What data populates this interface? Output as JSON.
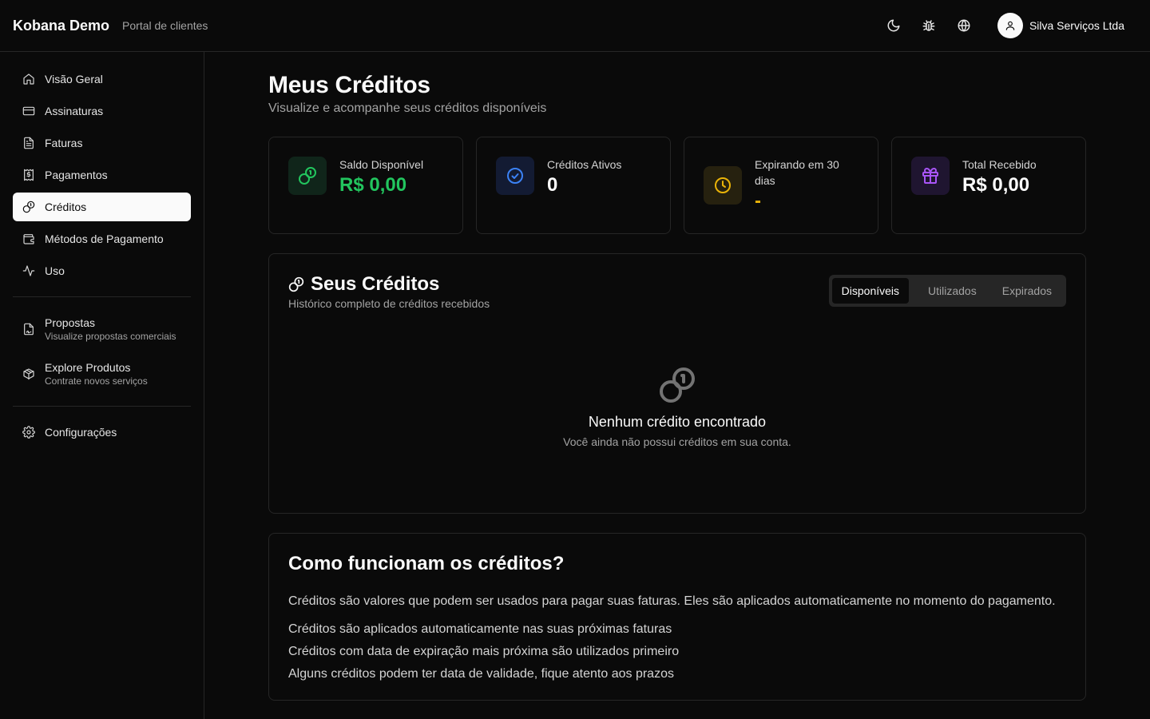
{
  "header": {
    "brand": "Kobana Demo",
    "subtitle": "Portal de clientes",
    "icons": [
      "moon-icon",
      "bug-icon",
      "globe-icon"
    ],
    "user_name": "Silva Serviços Ltda"
  },
  "sidebar": {
    "items": [
      {
        "label": "Visão Geral",
        "icon": "home-icon"
      },
      {
        "label": "Assinaturas",
        "icon": "credit-card-icon"
      },
      {
        "label": "Faturas",
        "icon": "file-text-icon"
      },
      {
        "label": "Pagamentos",
        "icon": "receipt-icon"
      },
      {
        "label": "Créditos",
        "icon": "coins-icon",
        "active": true
      },
      {
        "label": "Métodos de Pagamento",
        "icon": "wallet-icon"
      },
      {
        "label": "Uso",
        "icon": "activity-icon"
      }
    ],
    "secondary": [
      {
        "label": "Propostas",
        "description": "Visualize propostas comerciais",
        "icon": "file-signature-icon"
      },
      {
        "label": "Explore Produtos",
        "description": "Contrate novos serviços",
        "icon": "package-icon"
      }
    ],
    "settings": {
      "label": "Configurações",
      "icon": "gear-icon"
    }
  },
  "page": {
    "title": "Meus Créditos",
    "subtitle": "Visualize e acompanhe seus créditos disponíveis"
  },
  "stats": [
    {
      "label": "Saldo Disponível",
      "value": "R$ 0,00",
      "color": "#22c55e",
      "icon": "coins-icon"
    },
    {
      "label": "Créditos Ativos",
      "value": "0",
      "color": "#3b82f6",
      "icon": "check-circle-icon"
    },
    {
      "label": "Expirando em 30 dias",
      "value": "-",
      "color": "#eab308",
      "icon": "clock-icon"
    },
    {
      "label": "Total Recebido",
      "value": "R$ 0,00",
      "color": "#a855f7",
      "icon": "gift-icon"
    }
  ],
  "credits": {
    "title": "Seus Créditos",
    "subtitle": "Histórico completo de créditos recebidos",
    "tabs": [
      "Disponíveis",
      "Utilizados",
      "Expirados"
    ],
    "active_tab": "Disponíveis",
    "empty_title": "Nenhum crédito encontrado",
    "empty_subtitle": "Você ainda não possui créditos em sua conta."
  },
  "how": {
    "title": "Como funcionam os créditos?",
    "text": "Créditos são valores que podem ser usados para pagar suas faturas. Eles são aplicados automaticamente no momento do pagamento.",
    "items": [
      "Créditos são aplicados automaticamente nas suas próximas faturas",
      "Créditos com data de expiração mais próxima são utilizados primeiro",
      "Alguns créditos podem ter data de validade, fique atento aos prazos"
    ]
  }
}
